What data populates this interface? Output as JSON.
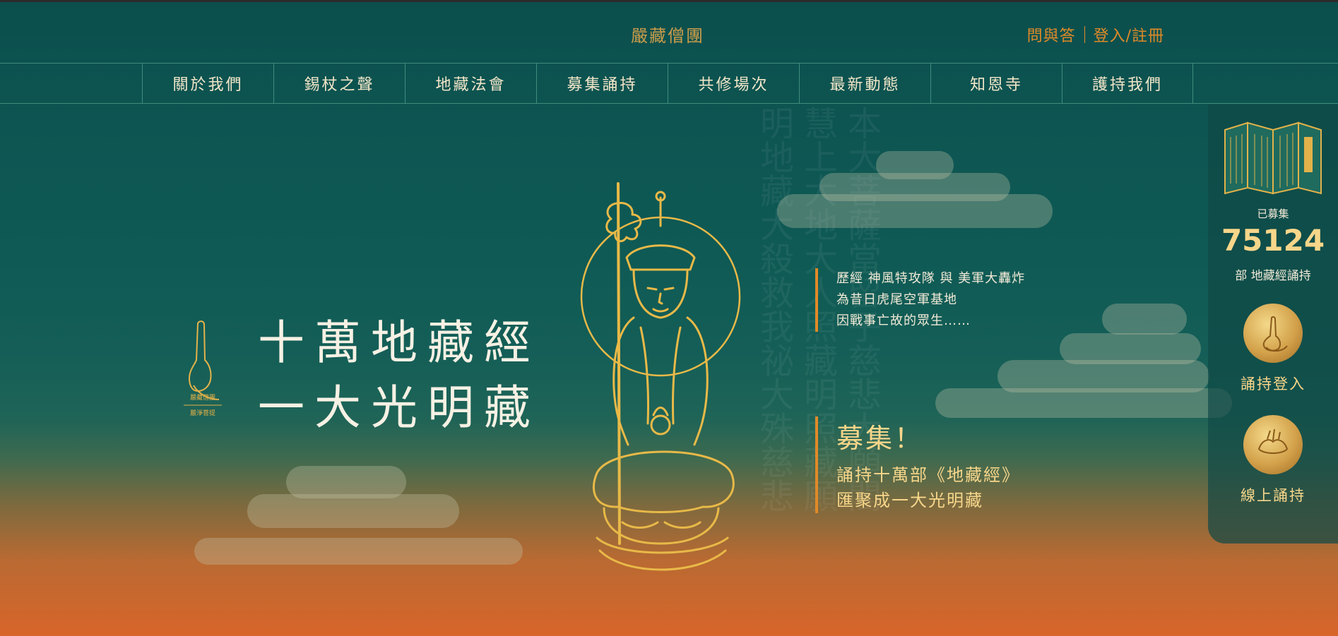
{
  "header": {
    "brand": "嚴藏僧團",
    "links": [
      "問與答",
      "登入/註冊"
    ]
  },
  "nav": {
    "items": [
      "關於我們",
      "錫杖之聲",
      "地藏法會",
      "募集誦持",
      "共修場次",
      "最新動態",
      "知恩寺",
      "護持我們"
    ]
  },
  "hero": {
    "title_lines": [
      "十萬地藏經",
      "一大光明藏"
    ],
    "logo_text": [
      "嚴藏僧團",
      "嚴淨菩提"
    ],
    "scripture_text": "本大菩薩當留子慈悲大願閣慧上大地大人照藏明照藏願明地藏大殺救我祕大殊慈悲"
  },
  "story": {
    "lines": [
      "歷經 神風特攻隊 與 美軍大轟炸",
      "為昔日虎尾空軍基地",
      "因戰事亡故的眾生……"
    ]
  },
  "call": {
    "title": "募集！",
    "lines": [
      "誦持十萬部《地藏經》",
      "匯聚成一大光明藏"
    ]
  },
  "side_panel": {
    "collected_label": "已募集",
    "count": "75124",
    "unit": "部 地藏經誦持",
    "buttons": [
      "誦持登入",
      "線上誦持"
    ],
    "icons": [
      "scripture-book-icon",
      "praying-hands-icon",
      "mudra-hands-icon"
    ]
  },
  "colors": {
    "teal": "#0d5552",
    "gold": "#e3b24a",
    "orange": "#e08a28",
    "cream": "#f6f1e4"
  }
}
